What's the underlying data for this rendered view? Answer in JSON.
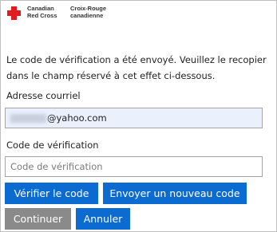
{
  "logo": {
    "english_line1": "Canadian",
    "english_line2": "Red Cross",
    "french_line1": "Croix-Rouge",
    "french_line2": "canadienne",
    "cross_color": "#e11b22"
  },
  "message": "Le code de vérification a été envoyé. Veuillez le recopier dans le champ réservé à cet effet ci-dessous.",
  "email": {
    "label": "Adresse courriel",
    "value_visible": "@yahoo.com"
  },
  "verification": {
    "label": "Code de vérification",
    "placeholder": "Code de vérification",
    "value": ""
  },
  "buttons": {
    "verify": "Vérifier le code",
    "send_new": "Envoyer un nouveau code",
    "continue": "Continuer",
    "cancel": "Annuler"
  },
  "colors": {
    "primary_button": "#0c6bd1",
    "disabled_button": "#8a8a8a",
    "email_field_bg": "#eaf1fd"
  }
}
